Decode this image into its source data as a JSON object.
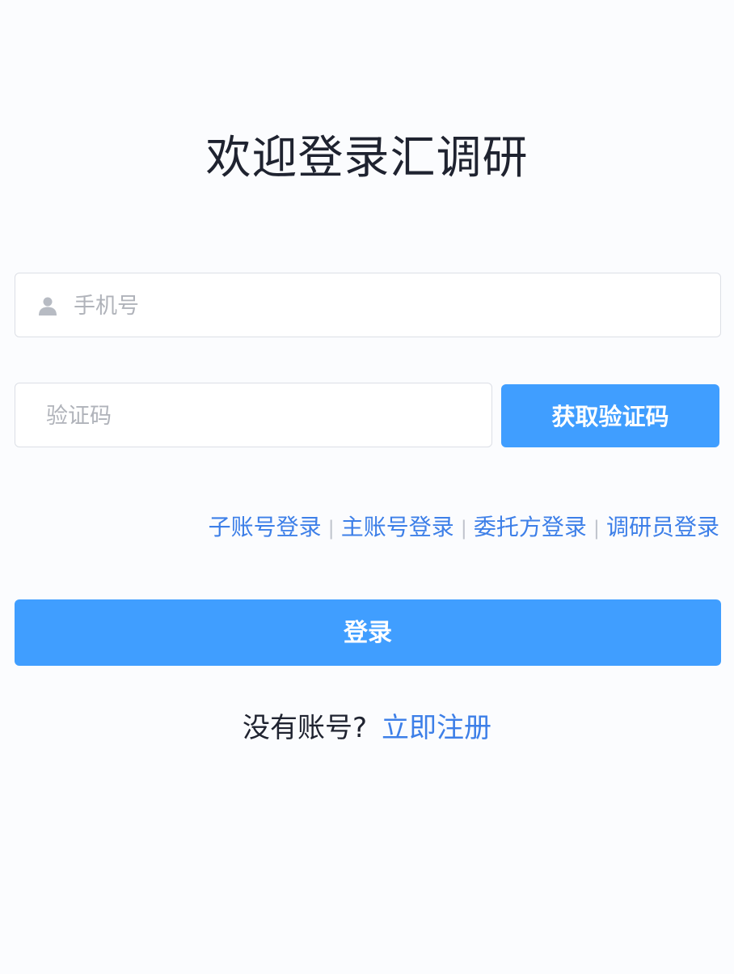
{
  "page": {
    "title": "欢迎登录汇调研"
  },
  "form": {
    "phone": {
      "placeholder": "手机号",
      "value": "",
      "icon": "user-icon"
    },
    "code": {
      "placeholder": "验证码",
      "value": ""
    },
    "get_code_label": "获取验证码",
    "login_label": "登录"
  },
  "login_types": {
    "items": [
      "子账号登录",
      "主账号登录",
      "委托方登录",
      "调研员登录"
    ],
    "separator": "|"
  },
  "register": {
    "question": "没有账号?",
    "link": "立即注册"
  },
  "colors": {
    "primary": "#409eff",
    "link": "#3d7fe8",
    "title": "#1f2330",
    "background": "#fbfcfe"
  }
}
